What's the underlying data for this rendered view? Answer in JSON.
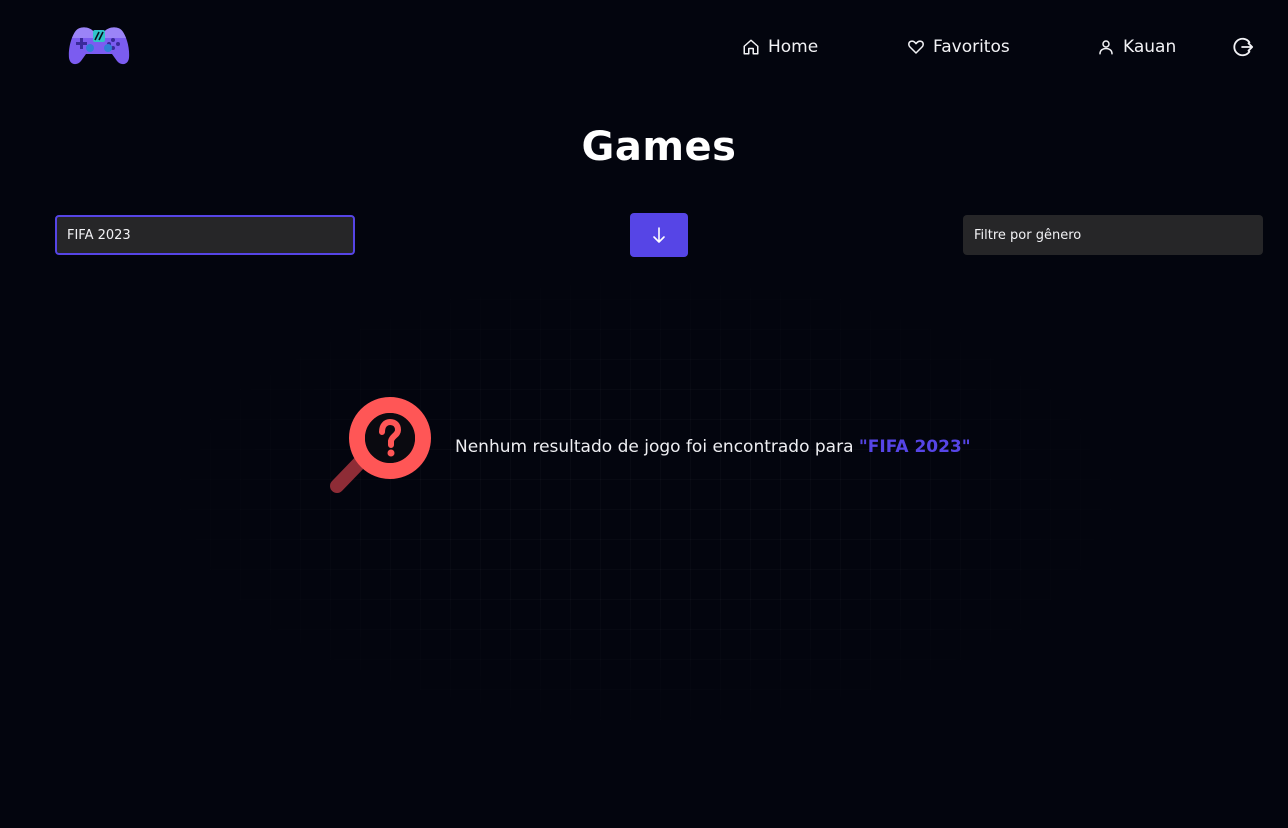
{
  "header": {
    "logo_icon": "gamepad-icon",
    "nav": {
      "home_label": "Home",
      "favorites_label": "Favoritos",
      "user_label": "Kauan"
    },
    "logout_icon": "logout-icon"
  },
  "main": {
    "title": "Games",
    "search": {
      "value": "FIFA 2023"
    },
    "sort_button_icon": "arrow-down-icon",
    "genre_filter": {
      "placeholder": "Filtre por gênero"
    },
    "empty_state": {
      "icon": "magnifier-question-icon",
      "message": "Nenhum resultado de jogo foi encontrado para",
      "query": "\"FIFA 2023\""
    }
  },
  "colors": {
    "background": "#03050e",
    "accent": "#5645e6",
    "input_bg": "#262628",
    "empty_icon": "#ff5656"
  }
}
